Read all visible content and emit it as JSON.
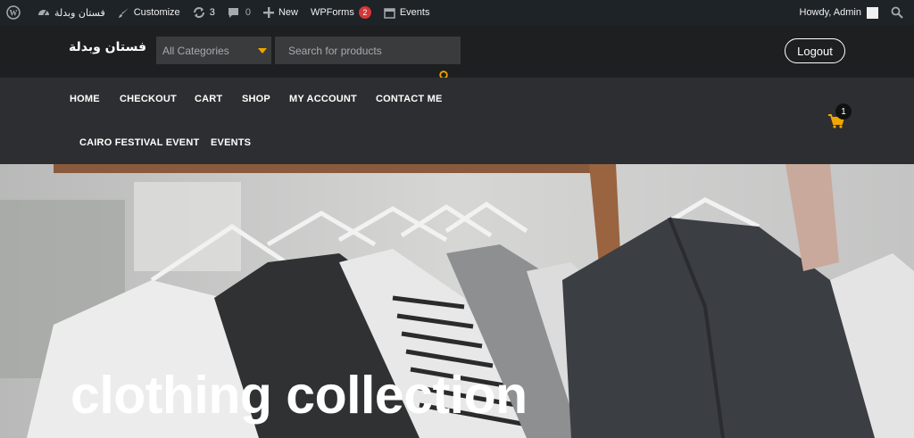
{
  "adminbar": {
    "site_name": "فستان وبدلة",
    "customize": "Customize",
    "updates_count": "3",
    "comments_count": "0",
    "new_label": "New",
    "wpforms_label": "WPForms",
    "wpforms_badge": "2",
    "events_label": "Events",
    "howdy": "Howdy, Admin"
  },
  "header": {
    "logo": "فستان وبدلة",
    "category_select": "All Categories",
    "search_placeholder": "Search for products",
    "logout": "Logout"
  },
  "nav": {
    "items": [
      "HOME",
      "CHECKOUT",
      "CART",
      "SHOP",
      "MY ACCOUNT",
      "CONTACT ME",
      "CAIRO FESTIVAL EVENT",
      "EVENTS"
    ],
    "cart_count": "1"
  },
  "hero": {
    "title": "clothing collection"
  },
  "colors": {
    "accent": "#f0a500",
    "adminbar_bg": "#1d2327",
    "header_bg": "#1e1f21",
    "nav_bg": "#2d2e31",
    "badge": "#d63638"
  },
  "icons": [
    "wordpress-icon",
    "dashboard-icon",
    "brush-icon",
    "updates-icon",
    "comment-icon",
    "plus-icon",
    "calendar-icon",
    "search-icon",
    "cart-icon"
  ]
}
